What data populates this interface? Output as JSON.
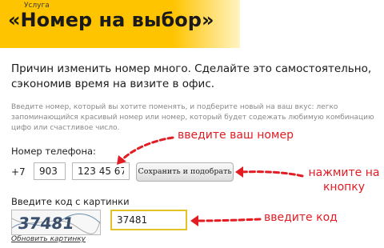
{
  "header": {
    "service_label": "Услуга",
    "title": "«Номер на выбор»"
  },
  "intro": "Причин изменить номер много. Сделайте это самостоятельно, сэкономив время на визите в офис.",
  "hint": "Введите номер, который вы хотите поменять, и подберите новый на ваш вкус: легко запоминающийся красивый номер или номер, который будет содежать любимую комбинацию цифо или счастливое число.",
  "phone": {
    "label": "Номер телефона:",
    "country_code": "+7",
    "code_value": "903",
    "number_value": "123 45 67",
    "submit_label": "Сохранить и подобрать"
  },
  "captcha": {
    "label": "Введите код с картинки",
    "image_text": "37481",
    "input_value": "37481",
    "refresh_label": "Обновить картинку"
  },
  "annotations": {
    "enter_number": "введите ваш номер",
    "press_button_line1": "нажмите на",
    "press_button_line2": "кнопку",
    "enter_code": "введите код"
  },
  "colors": {
    "banner": "#ffc400",
    "annotation": "#e31b23",
    "highlight_border": "#e3c227"
  }
}
